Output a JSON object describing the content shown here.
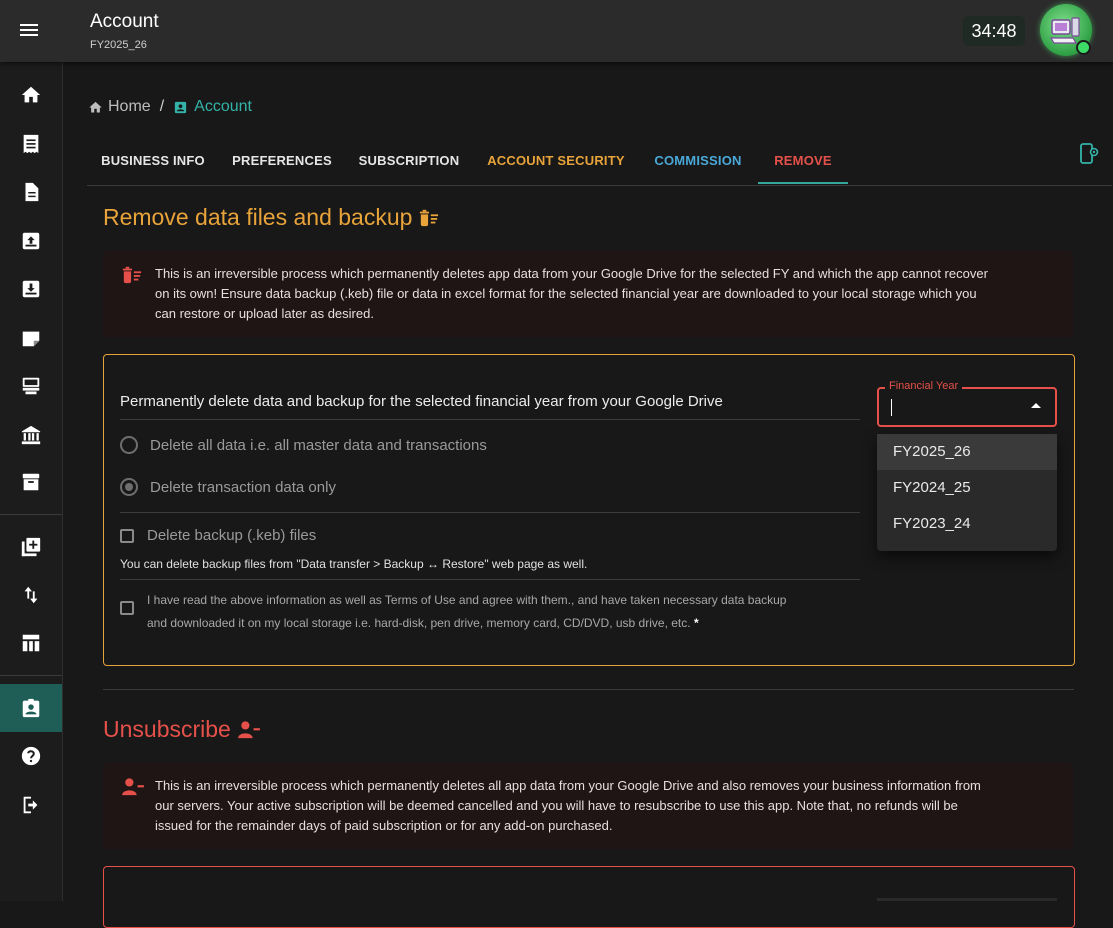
{
  "appbar": {
    "title": "Account",
    "subtitle": "FY2025_26",
    "timer": "34:48",
    "menu_icon": "menu-icon",
    "avatar_icon": "computer-avatar-icon"
  },
  "sidebar": {
    "items": [
      {
        "icon": "home-icon"
      },
      {
        "icon": "receipt-icon"
      },
      {
        "icon": "document-icon"
      },
      {
        "icon": "inbox-upload-icon"
      },
      {
        "icon": "inbox-download-icon"
      },
      {
        "icon": "note-icon"
      },
      {
        "icon": "point-of-sale-icon"
      },
      {
        "icon": "bank-icon"
      },
      {
        "icon": "archive-icon"
      },
      {
        "icon": "library-add-icon"
      },
      {
        "icon": "swap-vertical-icon"
      },
      {
        "icon": "table-icon"
      },
      {
        "icon": "account-box-icon",
        "active": true
      },
      {
        "icon": "help-icon"
      },
      {
        "icon": "logout-icon"
      }
    ]
  },
  "breadcrumb": {
    "home": "Home",
    "separator": "/",
    "current": "Account"
  },
  "tabs": [
    {
      "label": "BUSINESS INFO",
      "color": "#e6e6e6"
    },
    {
      "label": "PREFERENCES",
      "color": "#e6e6e6"
    },
    {
      "label": "SUBSCRIPTION",
      "color": "#e6e6e6"
    },
    {
      "label": "ACCOUNT SECURITY",
      "color": "#e8a33a"
    },
    {
      "label": "COMMISSION",
      "color": "#4aa8d8"
    },
    {
      "label": "REMOVE",
      "color": "#e5514a",
      "active": true
    }
  ],
  "remove_section": {
    "title": "Remove data files and backup",
    "title_color": "#e8a33a",
    "warning_lines": [
      "This is an irreversible process which permanently deletes app data from your Google Drive for the selected FY and which the app cannot recover",
      "on its own! Ensure data backup (.keb) file or data in excel format for the selected financial year are downloaded to your local storage which you",
      "can restore or upload later as desired."
    ],
    "card_title": "Permanently delete data and backup for the selected financial year from your Google Drive",
    "option_all": "Delete all data i.e. all master data and transactions",
    "option_transactions": "Delete transaction data only",
    "delete_backup_label": "Delete backup (.keb) files",
    "backup_hint": "You can delete backup files from \"Data transfer > Backup ↔ Restore\" web page as well.",
    "agree_line1": "I have read the above information as well as Terms of Use and agree with them., and have taken necessary data backup",
    "agree_line2": "and downloaded it on my local storage i.e. hard-disk, pen drive, memory card, CD/DVD, usb drive, etc.",
    "required_mark": "*",
    "financial_year": {
      "label": "Financial Year",
      "value": "",
      "options": [
        "FY2025_26",
        "FY2024_25",
        "FY2023_24"
      ],
      "highlighted": "FY2025_26"
    }
  },
  "unsubscribe_section": {
    "title": "Unsubscribe",
    "title_color": "#e5514a",
    "warning_lines": [
      "This is an irreversible process which permanently deletes all app data from your Google Drive and also removes your business information from",
      "our servers. Your active subscription will be deemed cancelled and you will have to resubscribe to use this app. Note that, no refunds will be",
      "issued for the remainder days of paid subscription or for any add-on purchased."
    ]
  },
  "colors": {
    "accent_teal": "#34b4a8",
    "warning_orange": "#e8a33a",
    "danger_red": "#e5514a",
    "info_blue": "#4aa8d8"
  }
}
